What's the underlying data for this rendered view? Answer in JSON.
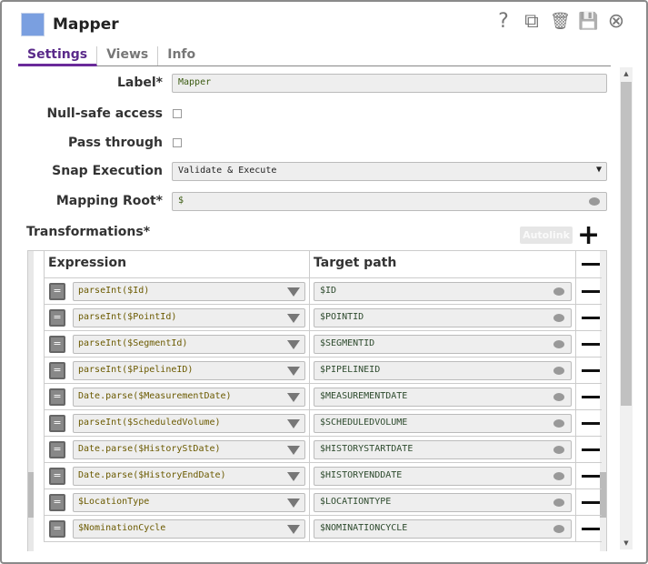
{
  "header": {
    "title": "Mapper",
    "icons": [
      "help-icon",
      "export-icon",
      "trash-icon",
      "save-icon",
      "close-icon"
    ],
    "icon_glyphs": [
      "?",
      "⧉",
      "🗑",
      "💾",
      "⊗"
    ]
  },
  "tabs": [
    "Settings",
    "Views",
    "Info"
  ],
  "form": {
    "label": {
      "label": "Label*",
      "value": "Mapper"
    },
    "null_safe": {
      "label": "Null-safe access",
      "checked": false
    },
    "pass_through": {
      "label": "Pass through",
      "checked": false
    },
    "snap_execution": {
      "label": "Snap Execution",
      "value": "Validate & Execute"
    },
    "mapping_root": {
      "label": "Mapping Root*",
      "value": "$"
    }
  },
  "transformations": {
    "title": "Transformations*",
    "autolink": "Autolink",
    "add": "+",
    "headers": {
      "expression": "Expression",
      "target": "Target path"
    },
    "eq": "=",
    "rows": [
      {
        "expression": "parseInt($Id)",
        "target": "$ID"
      },
      {
        "expression": "parseInt($PointId)",
        "target": "$POINTID"
      },
      {
        "expression": "parseInt($SegmentId)",
        "target": "$SEGMENTID"
      },
      {
        "expression": "parseInt($PipelineID)",
        "target": "$PIPELINEID"
      },
      {
        "expression": "Date.parse($MeasurementDate)",
        "target": "$MEASUREMENTDATE"
      },
      {
        "expression": "parseInt($ScheduledVolume)",
        "target": "$SCHEDULEDVOLUME"
      },
      {
        "expression": "Date.parse($HistoryStDate)",
        "target": "$HISTORYSTARTDATE"
      },
      {
        "expression": "Date.parse($HistoryEndDate)",
        "target": "$HISTORYENDDATE"
      },
      {
        "expression": "$LocationType",
        "target": "$LOCATIONTYPE"
      },
      {
        "expression": "$NominationCycle",
        "target": "$NOMINATIONCYCLE"
      }
    ]
  }
}
